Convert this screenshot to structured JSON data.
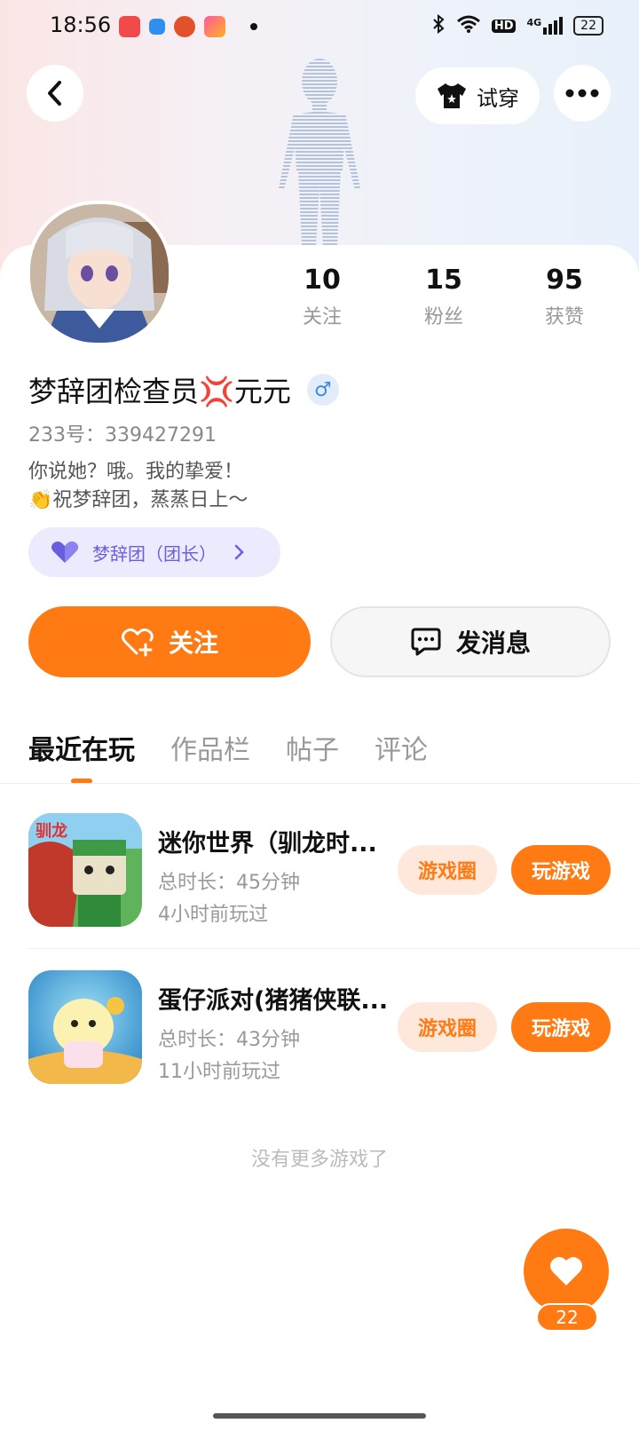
{
  "status_bar": {
    "time": "18:56",
    "battery": "22",
    "network": "4G",
    "hd": "HD"
  },
  "header": {
    "tryon_label": "试穿"
  },
  "profile": {
    "stats": [
      {
        "value": "10",
        "label": "关注"
      },
      {
        "value": "15",
        "label": "粉丝"
      },
      {
        "value": "95",
        "label": "获赞"
      }
    ],
    "username": "梦辞团检查员💢元元",
    "gender_symbol": "♂",
    "uid": "233号：339427291",
    "bio_line1": "你说她？哦。我的挚爱！",
    "bio_line2": "👏祝梦辞团，蒸蒸日上～",
    "club_label": "梦辞团（团长）"
  },
  "actions": {
    "follow_label": "关注",
    "message_label": "发消息"
  },
  "tabs": [
    "最近在玩",
    "作品栏",
    "帖子",
    "评论"
  ],
  "games": [
    {
      "title": "迷你世界（驯龙时...",
      "duration": "总时长：45分钟",
      "last_played": "4小时前玩过",
      "circle_label": "游戏圈",
      "play_label": "玩游戏"
    },
    {
      "title": "蛋仔派对(猪猪侠联...",
      "duration": "总时长：43分钟",
      "last_played": "11小时前玩过",
      "circle_label": "游戏圈",
      "play_label": "玩游戏"
    }
  ],
  "footer": {
    "no_more": "没有更多游戏了",
    "like_count": "22"
  },
  "colors": {
    "accent": "#ff7a13",
    "club_bg": "#ecebfd",
    "club_text": "#6a5ee0"
  }
}
